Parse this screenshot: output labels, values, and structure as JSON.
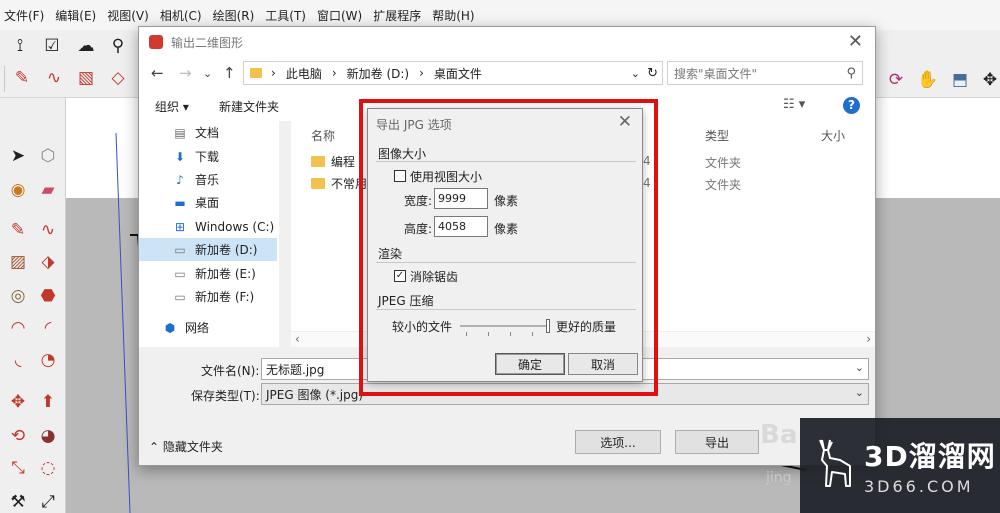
{
  "menubar": {
    "items": [
      "文件(F)",
      "编辑(E)",
      "视图(V)",
      "相机(C)",
      "绘图(R)",
      "工具(T)",
      "窗口(W)",
      "扩展程序",
      "帮助(H)"
    ]
  },
  "save_dialog": {
    "title": "输出二维图形",
    "breadcrumb": [
      "此电脑",
      "新加卷 (D:)",
      "桌面文件"
    ],
    "search_placeholder": "搜索\"桌面文件\"",
    "organize_label": "组织 ▾",
    "new_folder_label": "新建文件夹",
    "nav_items": [
      {
        "label": "文档",
        "icon": "document-icon"
      },
      {
        "label": "下载",
        "icon": "download-arrow-icon"
      },
      {
        "label": "音乐",
        "icon": "music-note-icon"
      },
      {
        "label": "桌面",
        "icon": "desktop-icon"
      },
      {
        "label": "Windows (C:)",
        "icon": "windows-drive-icon"
      },
      {
        "label": "新加卷 (D:)",
        "icon": "drive-icon"
      },
      {
        "label": "新加卷 (E:)",
        "icon": "drive-icon"
      },
      {
        "label": "新加卷 (F:)",
        "icon": "drive-icon"
      },
      {
        "label": "网络",
        "icon": "network-icon"
      }
    ],
    "selected_nav": "新加卷 (D:)",
    "columns": {
      "name": "名称",
      "type": "类型",
      "size": "大小"
    },
    "files": [
      {
        "name": "编程",
        "date_tail": "4",
        "type": "文件夹"
      },
      {
        "name": "不常用",
        "date_tail": "4",
        "type": "文件夹"
      }
    ],
    "filename_label": "文件名(N):",
    "filename_value": "无标题.jpg",
    "filetype_label": "保存类型(T):",
    "filetype_value": "JPEG 图像 (*.jpg)",
    "hide_folders_label": "隐藏文件夹",
    "options_button": "选项...",
    "export_button": "导出"
  },
  "jpg_options": {
    "title": "导出 JPG 选项",
    "image_size_group": "图像大小",
    "use_view_size_label": "使用视图大小",
    "use_view_size_checked": false,
    "width_label": "宽度:",
    "width_value": "9999",
    "height_label": "高度:",
    "height_value": "4058",
    "unit_label": "像素",
    "render_group": "渲染",
    "antialias_label": "消除锯齿",
    "antialias_checked": true,
    "jpeg_group": "JPEG 压缩",
    "smaller_label": "较小的文件",
    "better_label": "更好的质量",
    "quality_level": 1.0,
    "ok_button": "确定",
    "cancel_button": "取消"
  },
  "watermark": {
    "main": "3D溜溜网",
    "sub": "3D66.COM",
    "bai": "Ba",
    "jing": "jing"
  },
  "colors": {
    "highlight": "#e01010",
    "accent": "#1f6fd1",
    "folder": "#f2c14e"
  }
}
